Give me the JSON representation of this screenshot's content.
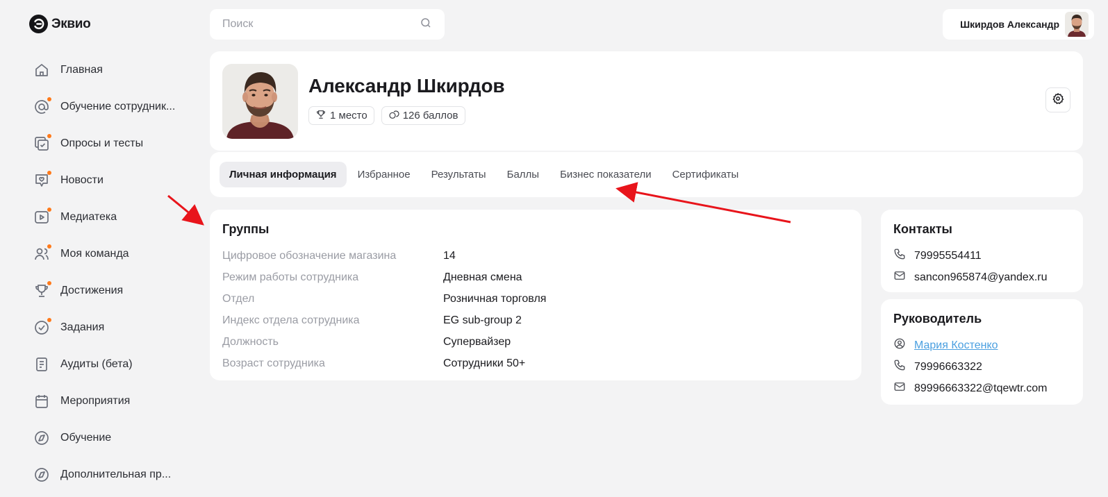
{
  "app": {
    "name": "Эквио"
  },
  "sidebar": {
    "items": [
      {
        "label": "Главная",
        "icon": "home-icon",
        "dot": false
      },
      {
        "label": "Обучение сотрудник...",
        "icon": "at-icon",
        "dot": true
      },
      {
        "label": "Опросы и тесты",
        "icon": "survey-icon",
        "dot": true
      },
      {
        "label": "Новости",
        "icon": "news-icon",
        "dot": true
      },
      {
        "label": "Медиатека",
        "icon": "media-icon",
        "dot": true
      },
      {
        "label": "Моя команда",
        "icon": "team-icon",
        "dot": true
      },
      {
        "label": "Достижения",
        "icon": "trophy-icon",
        "dot": true
      },
      {
        "label": "Задания",
        "icon": "check-circle-icon",
        "dot": true
      },
      {
        "label": "Аудиты (бета)",
        "icon": "document-icon",
        "dot": false
      },
      {
        "label": "Мероприятия",
        "icon": "calendar-icon",
        "dot": false
      },
      {
        "label": "Обучение",
        "icon": "compass-icon",
        "dot": false
      },
      {
        "label": "Дополнительная пр...",
        "icon": "compass-icon",
        "dot": false
      }
    ]
  },
  "search": {
    "placeholder": "Поиск",
    "icon": "search-icon"
  },
  "user": {
    "name": "Шкирдов Александр"
  },
  "profile": {
    "name": "Александр Шкирдов",
    "rank": "1 место",
    "points": "126 баллов"
  },
  "tabs": [
    {
      "label": "Личная информация",
      "active": true
    },
    {
      "label": "Избранное",
      "active": false
    },
    {
      "label": "Результаты",
      "active": false
    },
    {
      "label": "Баллы",
      "active": false
    },
    {
      "label": "Бизнес показатели",
      "active": false
    },
    {
      "label": "Сертификаты",
      "active": false
    }
  ],
  "groups": {
    "title": "Группы",
    "rows": [
      {
        "key": "Цифровое обозначение магазина",
        "value": "14"
      },
      {
        "key": "Режим работы сотрудника",
        "value": "Дневная смена"
      },
      {
        "key": "Отдел",
        "value": "Розничная торговля"
      },
      {
        "key": "Индекс отдела сотрудника",
        "value": "EG sub-group 2"
      },
      {
        "key": "Должность",
        "value": "Супервайзер"
      },
      {
        "key": "Возраст сотрудника",
        "value": "Сотрудники 50+"
      }
    ]
  },
  "contacts": {
    "title": "Контакты",
    "phone": "79995554411",
    "email": "sancon965874@yandex.ru"
  },
  "manager": {
    "title": "Руководитель",
    "name": "Мария Костенко",
    "phone": "79996663322",
    "email": "89996663322@tqewtr.com"
  },
  "colors": {
    "accent_dot": "#ff7a1a",
    "link": "#4a9fe0",
    "annotation_arrow": "#e8141b"
  }
}
